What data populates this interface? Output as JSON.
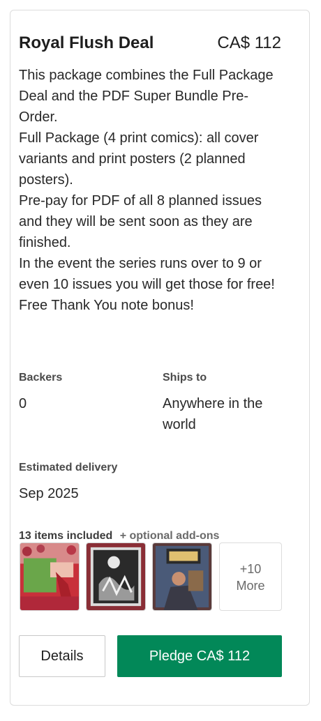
{
  "reward": {
    "title": "Royal Flush Deal",
    "price": "CA$ 112",
    "description": [
      "This package combines the Full Package Deal and the PDF Super Bundle Pre-Order.",
      "Full Package (4 print comics): all cover variants and print posters (2 planned posters).",
      "Pre-pay for PDF of all 8 planned issues and they will be sent soon as they are finished.",
      "In the event the series runs over to 9 or even 10 issues you will get those for free!",
      "Free Thank You note bonus!"
    ],
    "backers_label": "Backers",
    "backers_value": "0",
    "ships_label": "Ships to",
    "ships_value": "Anywhere in the world",
    "delivery_label": "Estimated delivery",
    "delivery_value": "Sep 2025",
    "items_included": "13 items included",
    "addons": "+ optional add-ons",
    "more_count": "+10",
    "more_label": "More",
    "details_button": "Details",
    "pledge_button": "Pledge CA$ 112"
  },
  "colors": {
    "pledge_green": "#028858",
    "text_dark": "#1e1e1e",
    "border": "#dcdcdc"
  }
}
